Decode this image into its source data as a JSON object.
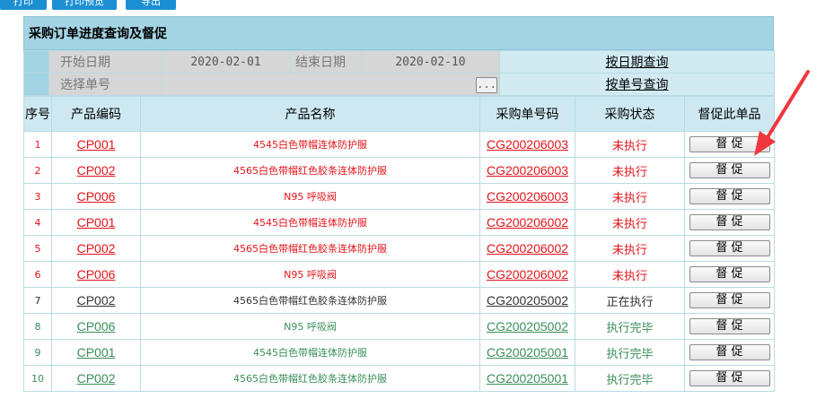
{
  "toolbar": {
    "buttons": [
      "打印",
      "打印预览",
      "导出"
    ]
  },
  "panel": {
    "title": "采购订单进度查询及督促"
  },
  "search": {
    "start_label": "开始日期",
    "start_value": "2020-02-01",
    "end_label": "结束日期",
    "end_value": "2020-02-10",
    "date_query": "按日期查询",
    "order_label": "选择单号",
    "order_value": "",
    "pick_label": "...",
    "order_query": "按单号查询"
  },
  "table": {
    "headers": [
      "序号",
      "产品编码",
      "产品名称",
      "采购单号码",
      "采购状态",
      "督促此单品"
    ],
    "button_label": "督 促",
    "rows": [
      {
        "no": "1",
        "code": "CP001",
        "name": "4545白色带帽连体防护服",
        "order": "CG200206003",
        "status": "未执行",
        "tone": "red"
      },
      {
        "no": "2",
        "code": "CP002",
        "name": "4565白色带帽红色胶条连体防护服",
        "order": "CG200206003",
        "status": "未执行",
        "tone": "red"
      },
      {
        "no": "3",
        "code": "CP006",
        "name": "N95 呼吸阀",
        "order": "CG200206003",
        "status": "未执行",
        "tone": "red"
      },
      {
        "no": "4",
        "code": "CP001",
        "name": "4545白色带帽连体防护服",
        "order": "CG200206002",
        "status": "未执行",
        "tone": "red"
      },
      {
        "no": "5",
        "code": "CP002",
        "name": "4565白色带帽红色胶条连体防护服",
        "order": "CG200206002",
        "status": "未执行",
        "tone": "red"
      },
      {
        "no": "6",
        "code": "CP006",
        "name": "N95 呼吸阀",
        "order": "CG200206002",
        "status": "未执行",
        "tone": "red"
      },
      {
        "no": "7",
        "code": "CP002",
        "name": "4565白色带帽红色胶条连体防护服",
        "order": "CG200205002",
        "status": "正在执行",
        "tone": "dark"
      },
      {
        "no": "8",
        "code": "CP006",
        "name": "N95 呼吸阀",
        "order": "CG200205002",
        "status": "执行完毕",
        "tone": "green"
      },
      {
        "no": "9",
        "code": "CP001",
        "name": "4545白色带帽连体防护服",
        "order": "CG200205001",
        "status": "执行完毕",
        "tone": "green"
      },
      {
        "no": "10",
        "code": "CP002",
        "name": "4565白色带帽红色胶条连体防护服",
        "order": "CG200205001",
        "status": "执行完毕",
        "tone": "green"
      }
    ]
  },
  "colors": {
    "red": "#e3141a",
    "dark": "#333333",
    "green": "#3a8f5a",
    "header_blue": "#a2d4e4",
    "arrow": "#f0373d"
  }
}
